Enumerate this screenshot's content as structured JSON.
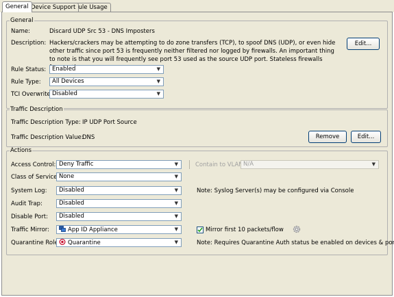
{
  "tabs": [
    {
      "label": "General"
    },
    {
      "label": "Device Support"
    },
    {
      "label": "Rule Usage"
    }
  ],
  "general": {
    "title": "General",
    "name_label": "Name:",
    "name_value": "Discard UDP Src 53 - DNS Imposters",
    "description_label": "Description:",
    "description_value": "Hackers/crackers may be attempting to do zone transfers (TCP), to spoof DNS (UDP), or even hide other traffic since port 53 is frequently neither filtered nor logged by firewalls.   An important thing to note is that you will frequently see port 53 used as the source UDP port. Stateless firewalls frequently...",
    "edit_label": "Edit...",
    "rule_status_label": "Rule Status:",
    "rule_status_value": "Enabled",
    "rule_type_label": "Rule Type:",
    "rule_type_value": "All Devices",
    "tci_overwrite_label": "TCI Overwrite:",
    "tci_overwrite_value": "Disabled"
  },
  "traffic": {
    "title": "Traffic Description",
    "type_label": "Traffic Description Type:",
    "type_value": "IP UDP Port Source",
    "value_label": "Traffic Description Value:",
    "value_value": "DNS",
    "remove_label": "Remove",
    "edit_label": "Edit..."
  },
  "actions": {
    "title": "Actions",
    "access_control_label": "Access Control:",
    "access_control_value": "Deny Traffic",
    "contain_vlan_label": "Contain to VLAN:",
    "contain_vlan_value": "N/A",
    "class_of_service_label": "Class of Service:",
    "class_of_service_value": "None",
    "system_log_label": "System Log:",
    "system_log_value": "Disabled",
    "system_log_note": "Note: Syslog Server(s) may be configured via Console",
    "audit_trap_label": "Audit Trap:",
    "audit_trap_value": "Disabled",
    "disable_port_label": "Disable Port:",
    "disable_port_value": "Disabled",
    "traffic_mirror_label": "Traffic Mirror:",
    "traffic_mirror_value": "App ID Appliance",
    "mirror_first_label": "Mirror first 10 packets/flow",
    "mirror_first_checked": true,
    "quarantine_role_label": "Quarantine Role:",
    "quarantine_role_value": "Quarantine",
    "quarantine_note": "Note: Requires Quarantine Auth status be enabled on devices & ports"
  },
  "icons": {
    "dropdown_arrow": "chevron-down-icon",
    "appliance": "appliance-icon",
    "quarantine": "quarantine-icon",
    "settings": "gear-icon",
    "checkmark": "checkmark-icon"
  },
  "colors": {
    "panel_bg": "#ece9d8",
    "input_border": "#7f9db9",
    "button_border": "#003c74",
    "quarantine_red": "#c8102e",
    "check_green": "#21a121"
  }
}
